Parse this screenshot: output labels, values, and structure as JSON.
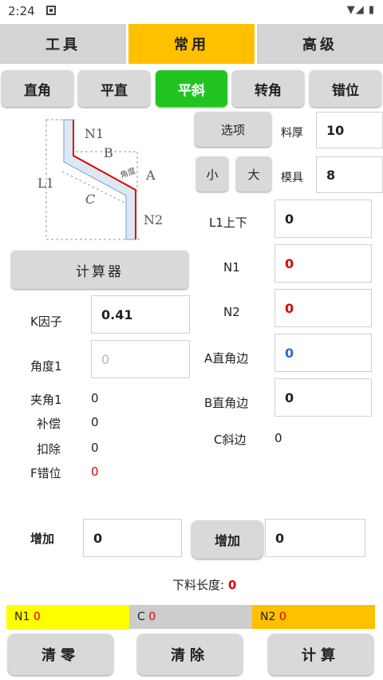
{
  "status_bar": {
    "time": "2:24",
    "icons_right": "▼◢ ▮"
  },
  "top_tabs": [
    {
      "label": "工具",
      "active": false
    },
    {
      "label": "常用",
      "active": true
    },
    {
      "label": "高级",
      "active": false
    }
  ],
  "sub_tabs": [
    {
      "label": "直角",
      "active": false
    },
    {
      "label": "平直",
      "active": false
    },
    {
      "label": "平斜",
      "active": true
    },
    {
      "label": "转角",
      "active": false
    },
    {
      "label": "错位",
      "active": false
    }
  ],
  "diagram": {
    "labels": {
      "n1": "N1",
      "b": "B",
      "angle": "角度",
      "a": "A",
      "l1": "L1",
      "c": "C",
      "n2": "N2"
    }
  },
  "controls": {
    "options_label": "选项",
    "thickness_label": "料厚",
    "thickness_value": "10",
    "small_label": "小",
    "large_label": "大",
    "die_label": "模具",
    "die_value": "8",
    "calculator_label": "计算器"
  },
  "fields": {
    "l1_label": "L1上下",
    "l1_value": "0",
    "n1_label": "N1",
    "n1_value": "0",
    "n2_label": "N2",
    "n2_value": "0",
    "a_label": "A直角边",
    "a_value": "0",
    "b_label": "B直角边",
    "b_value": "0",
    "c_label": "C斜边",
    "c_value": "0",
    "k_label": "K因子",
    "k_value": "0.41",
    "angle1_label": "角度1",
    "angle1_placeholder": "0"
  },
  "results": [
    {
      "label": "夹角1",
      "value": "0"
    },
    {
      "label": "补偿",
      "value": "0"
    },
    {
      "label": "扣除",
      "value": "0"
    },
    {
      "label": "F错位",
      "value": "0"
    }
  ],
  "increase": {
    "left_label": "增加",
    "left_value": "0",
    "right_button": "增加",
    "right_value": "0"
  },
  "cut_length": {
    "label": "下料长度:",
    "value": "0"
  },
  "summary_bar": [
    {
      "label": "N1",
      "value": "0"
    },
    {
      "label": "C",
      "value": "0"
    },
    {
      "label": "N2",
      "value": "0"
    }
  ],
  "bottom_buttons": {
    "zero": "清零",
    "clear": "清除",
    "calc": "计算"
  },
  "colors": {
    "active_top": "#ffc000",
    "active_sub": "#22c422",
    "red": "#e00000",
    "blue": "#2a6bd9",
    "bar_yellow": "#ffff00",
    "bar_gray": "#cccccc",
    "bar_orange": "#ffc000"
  }
}
